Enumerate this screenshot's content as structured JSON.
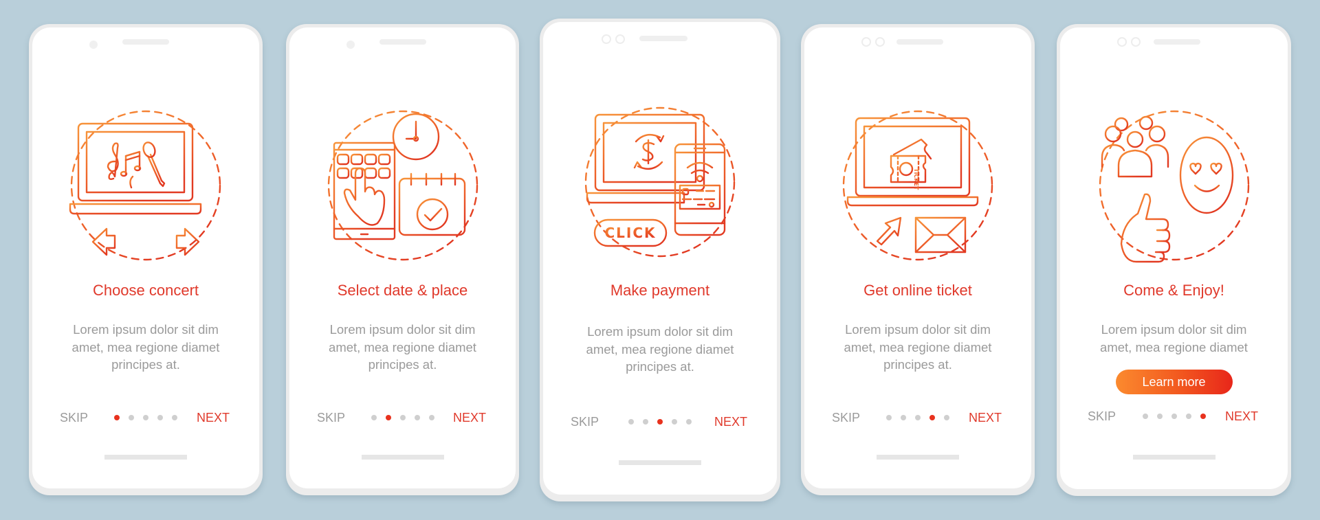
{
  "colors": {
    "background": "#b9cfda",
    "accent": "#e0392b",
    "gradient_start": "#fb8a2e",
    "gradient_end": "#e8261a",
    "body_text": "#9a9a9a",
    "dot_inactive": "#cfcfcf"
  },
  "screens": [
    {
      "title": "Choose concert",
      "body_lines": [
        "Lorem ipsum dolor sit dim",
        "amet, mea regione diamet",
        "principes at."
      ],
      "icon": "laptop-music-arrows-icon",
      "skip_label": "SKIP",
      "next_label": "NEXT",
      "page_index": 1,
      "page_total": 5
    },
    {
      "title": "Select date & place",
      "body_lines": [
        "Lorem ipsum dolor sit dim",
        "amet, mea regione diamet",
        "principes at."
      ],
      "icon": "tablet-clock-calendar-icon",
      "skip_label": "SKIP",
      "next_label": "NEXT",
      "page_index": 2,
      "page_total": 5
    },
    {
      "title": "Make payment",
      "body_lines": [
        "Lorem ipsum dolor sit dim",
        "amet, mea regione diamet",
        "principes at."
      ],
      "icon": "laptop-payment-phone-icon",
      "click_label": "CLICK",
      "skip_label": "SKIP",
      "next_label": "NEXT",
      "page_index": 3,
      "page_total": 5
    },
    {
      "title": "Get online ticket",
      "body_lines": [
        "Lorem ipsum dolor sit dim",
        "amet, mea regione diamet",
        "principes at."
      ],
      "icon": "laptop-ticket-mail-icon",
      "ticket_label": "TICKET",
      "skip_label": "SKIP",
      "next_label": "NEXT",
      "page_index": 4,
      "page_total": 5
    },
    {
      "title": "Come & Enjoy!",
      "body_lines": [
        "Lorem ipsum dolor sit dim",
        "amet, mea regione diamet"
      ],
      "icon": "crowd-thumbsup-smiley-icon",
      "button_label": "Learn more",
      "skip_label": "SKIP",
      "next_label": "NEXT",
      "page_index": 5,
      "page_total": 5
    }
  ]
}
